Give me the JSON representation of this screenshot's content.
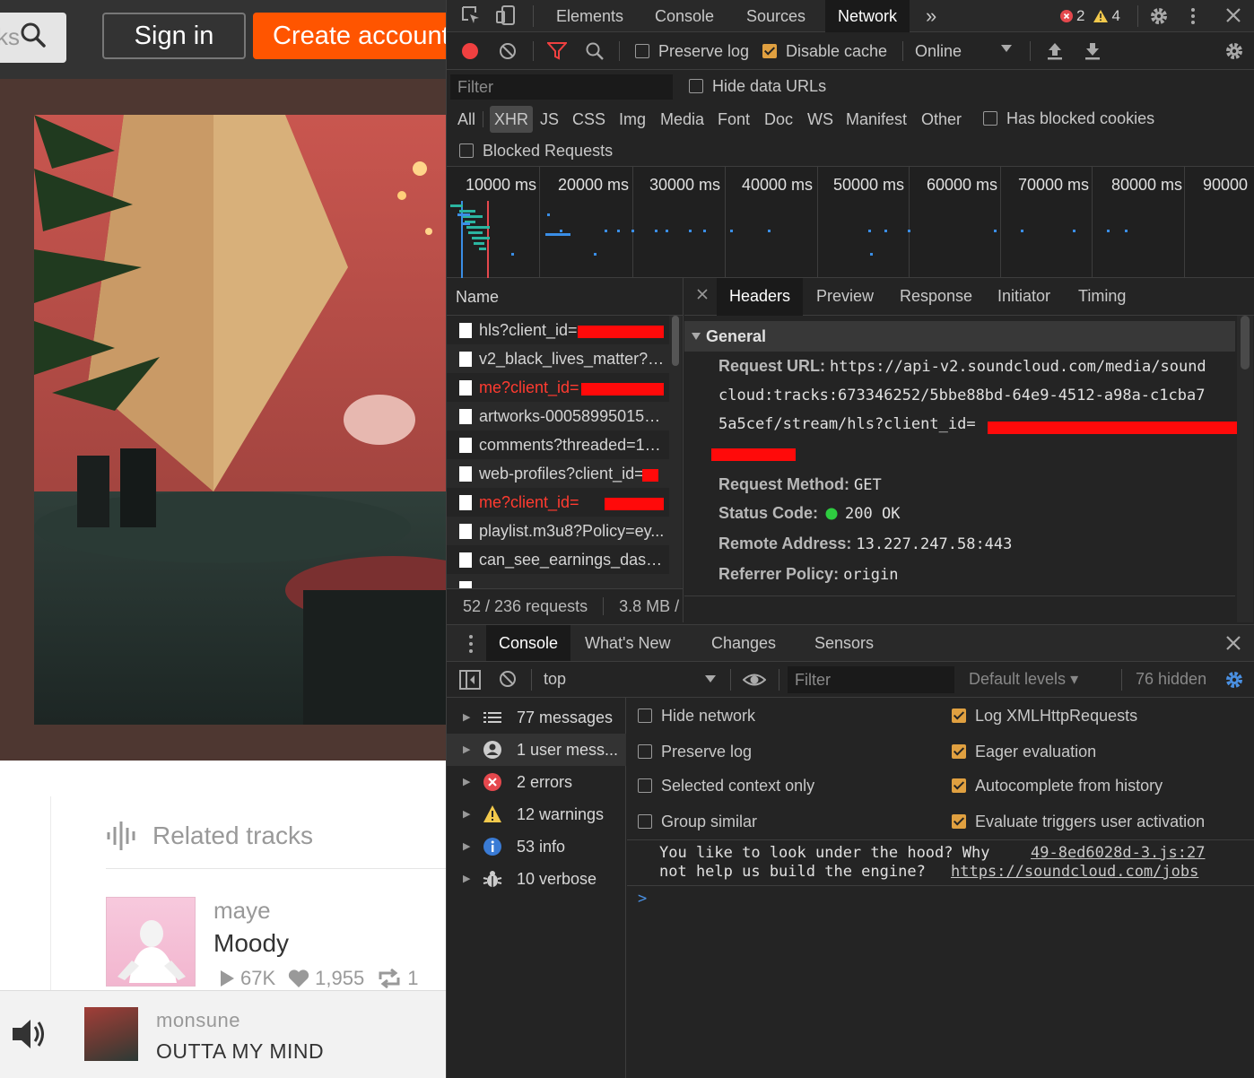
{
  "soundcloud": {
    "search_text": "ks",
    "signin_label": "Sign in",
    "create_label": "Create account",
    "related_title": "Related tracks",
    "related_track": {
      "artist": "maye",
      "title": "Moody",
      "plays": "67K",
      "likes": "1,955",
      "reposts": "1"
    },
    "player": {
      "artist": "monsune",
      "title": "OUTTA MY MIND"
    }
  },
  "devtools": {
    "tabs": [
      "Elements",
      "Console",
      "Sources",
      "Network"
    ],
    "active_tab": "Network",
    "more_tabs": "»",
    "error_count": "2",
    "warning_count": "4",
    "toolbar": {
      "preserve_log": "Preserve log",
      "disable_cache": "Disable cache",
      "throttle": "Online"
    },
    "filter": {
      "placeholder": "Filter",
      "hide_data_urls": "Hide data URLs",
      "types": [
        "All",
        "XHR",
        "JS",
        "CSS",
        "Img",
        "Media",
        "Font",
        "Doc",
        "WS",
        "Manifest",
        "Other"
      ],
      "active_type": "XHR",
      "has_blocked_cookies": "Has blocked cookies",
      "blocked_requests": "Blocked Requests"
    },
    "timeline_labels": [
      "10000 ms",
      "20000 ms",
      "30000 ms",
      "40000 ms",
      "50000 ms",
      "60000 ms",
      "70000 ms",
      "80000 ms",
      "90000"
    ],
    "request_list": {
      "header": "Name",
      "requests": [
        {
          "name": "hls?client_id=",
          "status": "ok"
        },
        {
          "name": "v2_black_lives_matter?c...",
          "status": "ok"
        },
        {
          "name": "me?client_id=",
          "status": "error"
        },
        {
          "name": "artworks-000589950152...",
          "status": "ok"
        },
        {
          "name": "comments?threaded=1&...",
          "status": "ok"
        },
        {
          "name": "web-profiles?client_id=",
          "status": "ok"
        },
        {
          "name": "me?client_id=",
          "status": "error"
        },
        {
          "name": "playlist.m3u8?Policy=ey...",
          "status": "ok"
        },
        {
          "name": "can_see_earnings_dash...",
          "status": "ok"
        }
      ],
      "footer_count": "52 / 236 requests",
      "footer_size": "3.8 MB /"
    },
    "detail": {
      "tabs": [
        "Headers",
        "Preview",
        "Response",
        "Initiator",
        "Timing"
      ],
      "active_tab": "Headers",
      "section": "General",
      "request_url_label": "Request URL:",
      "request_url_lines": [
        "https://api-v2.soundcloud.com/media/sound",
        "cloud:tracks:673346252/5bbe88bd-64e9-4512-a98a-c1cba7",
        "5a5cef/stream/hls?client_id="
      ],
      "method_label": "Request Method:",
      "method": "GET",
      "status_label": "Status Code:",
      "status": "200 OK",
      "status_color": "#22c55e",
      "remote_label": "Remote Address:",
      "remote": "13.227.247.58:443",
      "referrer_label": "Referrer Policy:",
      "referrer": "origin"
    },
    "drawer": {
      "tabs": [
        "Console",
        "What's New",
        "Changes",
        "Sensors"
      ],
      "active_tab": "Console",
      "context": "top",
      "filter_placeholder": "Filter",
      "levels": "Default levels",
      "hidden": "76 hidden",
      "sidebar": [
        {
          "icon": "list-icon",
          "label": "77 messages"
        },
        {
          "icon": "user-icon",
          "label": "1 user mess..."
        },
        {
          "icon": "error-icon",
          "label": "2 errors"
        },
        {
          "icon": "warning-icon",
          "label": "12 warnings"
        },
        {
          "icon": "info-icon",
          "label": "53 info"
        },
        {
          "icon": "bug-icon",
          "label": "10 verbose"
        }
      ],
      "options_left": [
        {
          "label": "Hide network",
          "checked": false
        },
        {
          "label": "Preserve log",
          "checked": false
        },
        {
          "label": "Selected context only",
          "checked": false
        },
        {
          "label": "Group similar",
          "checked": false
        }
      ],
      "options_right": [
        {
          "label": "Log XMLHttpRequests",
          "checked": true
        },
        {
          "label": "Eager evaluation",
          "checked": true
        },
        {
          "label": "Autocomplete from history",
          "checked": true
        },
        {
          "label": "Evaluate triggers user activation",
          "checked": true
        }
      ],
      "message": {
        "line1": "You like to look under the hood? Why",
        "line2": "not help us build the engine?",
        "link": "https://soundcloud.com/jobs",
        "source": "49-8ed6028d-3.js:27"
      },
      "prompt": ">"
    }
  }
}
